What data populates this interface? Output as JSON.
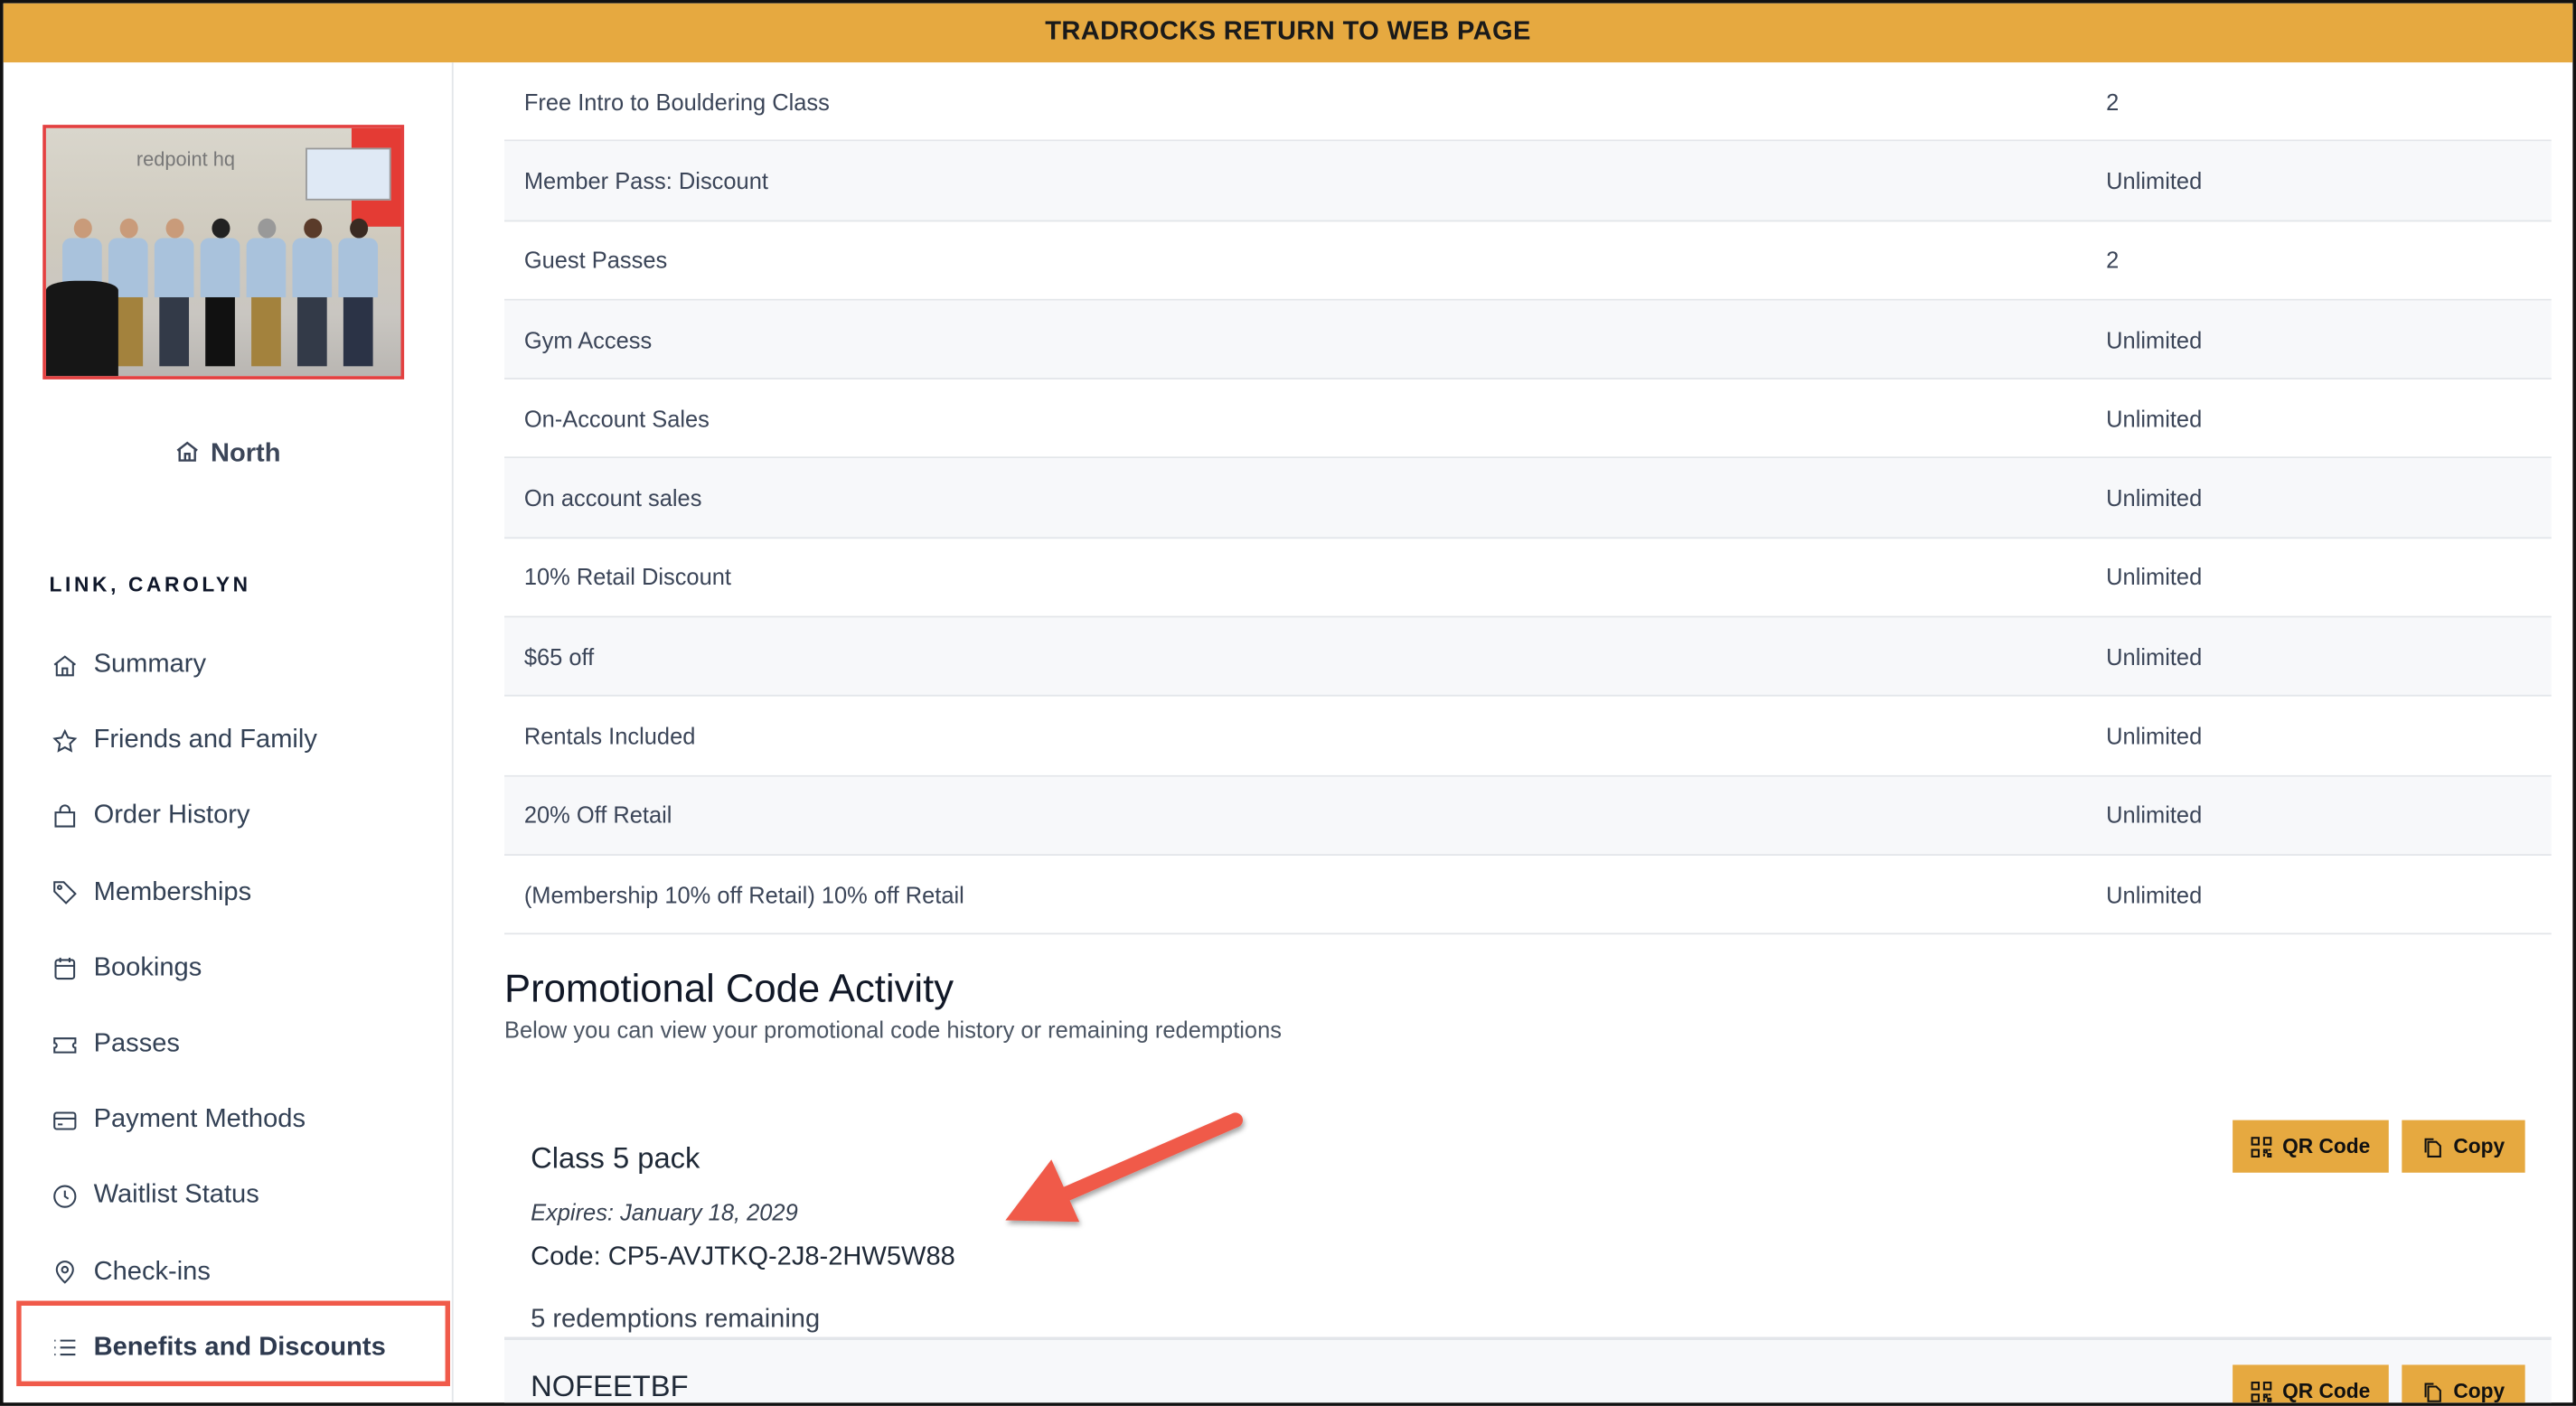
{
  "topbar": {
    "label": "TRADROCKS RETURN TO WEB PAGE"
  },
  "sidebar": {
    "location": "North",
    "user_name": "LINK, CAROLYN",
    "photo_logo_text": "redpoint hq",
    "items": [
      {
        "label": "Summary",
        "icon": "home-icon"
      },
      {
        "label": "Friends and Family",
        "icon": "star-icon"
      },
      {
        "label": "Order History",
        "icon": "shopping-bag-icon"
      },
      {
        "label": "Memberships",
        "icon": "tag-icon"
      },
      {
        "label": "Bookings",
        "icon": "calendar-icon"
      },
      {
        "label": "Passes",
        "icon": "ticket-icon"
      },
      {
        "label": "Payment Methods",
        "icon": "credit-card-icon"
      },
      {
        "label": "Waitlist Status",
        "icon": "clock-icon"
      },
      {
        "label": "Check-ins",
        "icon": "map-pin-icon"
      },
      {
        "label": "Benefits and Discounts",
        "icon": "list-icon",
        "active": true
      }
    ]
  },
  "benefits": [
    {
      "name": "Free Intro to Bouldering Class",
      "value": "2"
    },
    {
      "name": "Member Pass: Discount",
      "value": "Unlimited"
    },
    {
      "name": "Guest Passes",
      "value": "2"
    },
    {
      "name": "Gym Access",
      "value": "Unlimited"
    },
    {
      "name": "On-Account Sales",
      "value": "Unlimited"
    },
    {
      "name": "On account sales",
      "value": "Unlimited"
    },
    {
      "name": "10% Retail Discount",
      "value": "Unlimited"
    },
    {
      "name": "$65 off",
      "value": "Unlimited"
    },
    {
      "name": "Rentals Included",
      "value": "Unlimited"
    },
    {
      "name": "20% Off Retail",
      "value": "Unlimited"
    },
    {
      "name": "(Membership 10% off Retail) 10% off Retail",
      "value": "Unlimited"
    }
  ],
  "promo": {
    "title": "Promotional Code Activity",
    "subtitle": "Below you can view your promotional code history or remaining redemptions",
    "qr_label": "QR Code",
    "copy_label": "Copy",
    "cards": [
      {
        "title": "Class 5 pack",
        "expires": "Expires: January 18, 2029",
        "code": "Code: CP5-AVJTKQ-2J8-2HW5W88",
        "remaining": "5 redemptions remaining"
      },
      {
        "title": "NOFEETBF"
      }
    ]
  },
  "colors": {
    "accent": "#E6A940",
    "annotation": "#F05A4A"
  }
}
